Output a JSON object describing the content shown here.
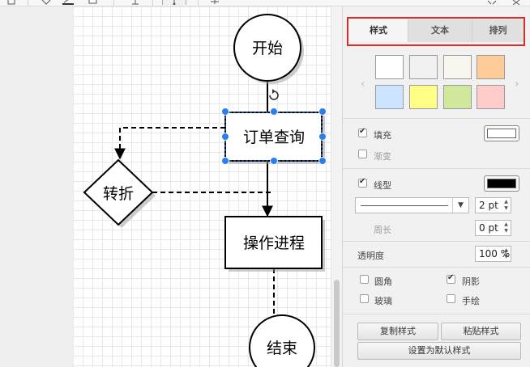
{
  "toolbar": {
    "icons": [
      "page-icon",
      "fill-color-icon",
      "line-color-icon",
      "shadow-icon",
      "waypoint-icon",
      "insert-icon",
      "fullscreen-icon",
      "close-icon"
    ]
  },
  "diagram": {
    "nodes": [
      {
        "id": "start",
        "label": "开始",
        "shape": "circle"
      },
      {
        "id": "order",
        "label": "订单查询",
        "shape": "rect",
        "selected": true
      },
      {
        "id": "turn",
        "label": "转折",
        "shape": "diamond"
      },
      {
        "id": "process",
        "label": "操作进程",
        "shape": "rect"
      },
      {
        "id": "end",
        "label": "结束",
        "shape": "circle"
      }
    ]
  },
  "panel": {
    "tabs": [
      {
        "label": "样式"
      },
      {
        "label": "文本"
      },
      {
        "label": "排列"
      }
    ],
    "swatches": [
      "#ffffff",
      "#f1f1f1",
      "#f8f6ee",
      "#ffcb99",
      "#cce4ff",
      "#ffff88",
      "#cfe89c",
      "#ffcccc"
    ],
    "fill": {
      "label": "填充",
      "checked": true,
      "color": "#ffffff"
    },
    "gradient": {
      "label": "渐变",
      "checked": false
    },
    "line": {
      "label": "线型",
      "checked": true,
      "color": "#000000",
      "width": "2 pt"
    },
    "perimeter": {
      "label": "周长",
      "value": "0 pt"
    },
    "opacity": {
      "label": "透明度",
      "value": "100 %"
    },
    "options": [
      {
        "label": "圆角",
        "checked": false
      },
      {
        "label": "阴影",
        "checked": true
      },
      {
        "label": "玻璃",
        "checked": false
      },
      {
        "label": "手绘",
        "checked": false
      }
    ],
    "buttons": {
      "copy_style": "复制样式",
      "paste_style": "粘贴样式",
      "set_default": "设置为默认样式"
    }
  }
}
